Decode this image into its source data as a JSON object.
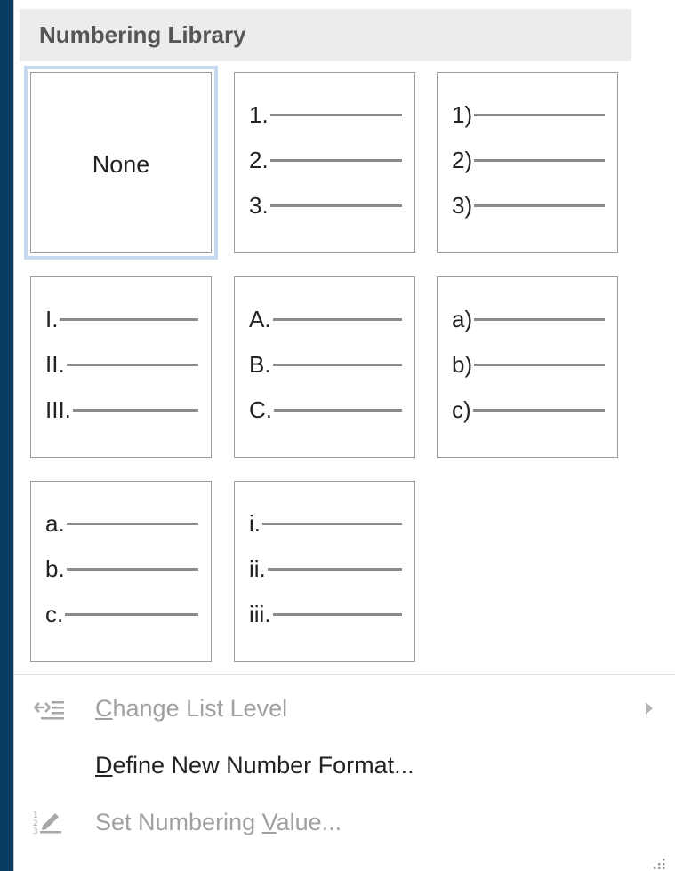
{
  "library": {
    "title": "Numbering Library",
    "none_label": "None",
    "formats": [
      {
        "markers": [
          "1.",
          "2.",
          "3."
        ]
      },
      {
        "markers": [
          "1)",
          "2)",
          "3)"
        ]
      },
      {
        "markers": [
          "I.",
          "II.",
          "III."
        ]
      },
      {
        "markers": [
          "A.",
          "B.",
          "C."
        ]
      },
      {
        "markers": [
          "a)",
          "b)",
          "c)"
        ]
      },
      {
        "markers": [
          "a.",
          "b.",
          "c."
        ]
      },
      {
        "markers": [
          "i.",
          "ii.",
          "iii."
        ]
      }
    ]
  },
  "menu": {
    "change_list_level": {
      "accel": "C",
      "rest": "hange List Level",
      "icon": "change-list-level-icon",
      "disabled": true
    },
    "define_new_format": {
      "accel": "D",
      "rest": "efine New Number Format...",
      "disabled": false
    },
    "set_numbering_value": {
      "pre": "Set Numbering ",
      "accel": "V",
      "rest": "alue...",
      "icon": "set-numbering-value-icon",
      "disabled": true
    }
  },
  "colors": {
    "backdrop": "#0a3d62",
    "selection": "#c5d9f1",
    "disabled_text": "#a0a0a0"
  }
}
